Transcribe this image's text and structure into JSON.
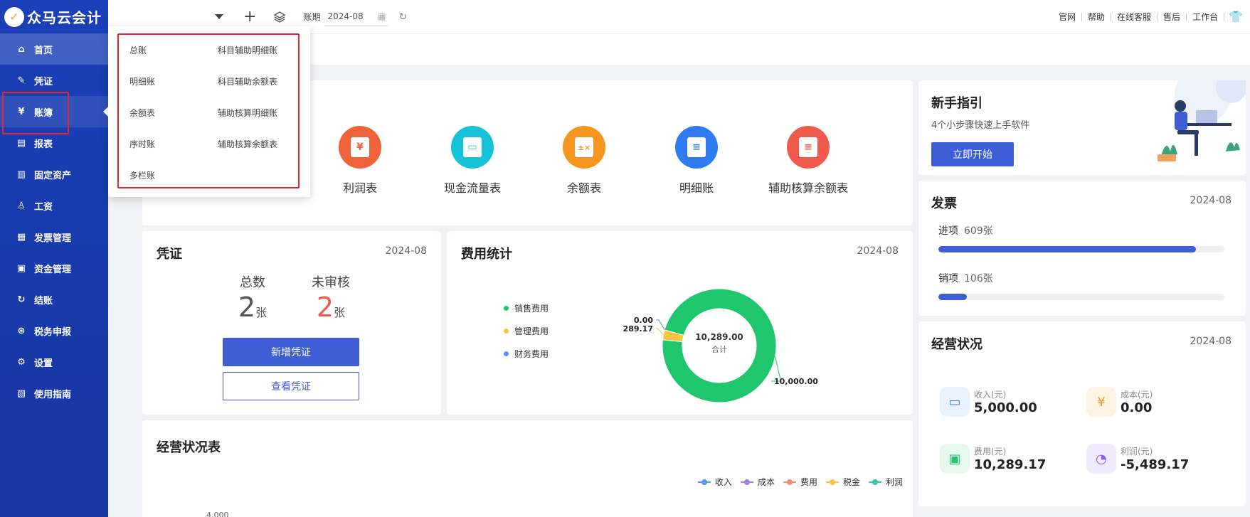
{
  "app": {
    "name": "众马云会计"
  },
  "nav": {
    "items": [
      {
        "label": "首页"
      },
      {
        "label": "凭证"
      },
      {
        "label": "账簿"
      },
      {
        "label": "报表"
      },
      {
        "label": "固定资产"
      },
      {
        "label": "工资"
      },
      {
        "label": "发票管理"
      },
      {
        "label": "资金管理"
      },
      {
        "label": "结账"
      },
      {
        "label": "税务申报"
      },
      {
        "label": "设置"
      },
      {
        "label": "使用指南"
      }
    ]
  },
  "topbar": {
    "period_label": "账期",
    "period_value": "2024-08",
    "links": [
      "官网",
      "帮助",
      "在线客服",
      "售后",
      "工作台"
    ]
  },
  "dropdown": {
    "left": [
      "总账",
      "明细账",
      "余额表",
      "序时账",
      "多栏账"
    ],
    "right": [
      "科目辅助明细账",
      "科目辅助余额表",
      "辅助核算明细账",
      "辅助核算余额表"
    ]
  },
  "quick": {
    "items": [
      {
        "label": "利润表",
        "icon": "yen-document-icon",
        "color": "#f0623a"
      },
      {
        "label": "现金流量表",
        "icon": "wallet-icon",
        "color": "#17c3d9"
      },
      {
        "label": "余额表",
        "icon": "calculator-icon",
        "color": "#f7961e"
      },
      {
        "label": "明细账",
        "icon": "clipboard-icon",
        "color": "#2f7cf2"
      },
      {
        "label": "辅助核算余额表",
        "icon": "document-icon",
        "color": "#f05a4a"
      }
    ]
  },
  "voucher": {
    "title": "凭证",
    "date": "2024-08",
    "total_label": "总数",
    "total_value": "2",
    "unreviewed_label": "未审核",
    "unreviewed_value": "2",
    "unit": "张",
    "add_button": "新增凭证",
    "view_button": "查看凭证"
  },
  "expense": {
    "title": "费用统计",
    "date": "2024-08",
    "legend": [
      {
        "label": "销售费用",
        "color": "#1fc66e"
      },
      {
        "label": "管理费用",
        "color": "#f5c542"
      },
      {
        "label": "财务费用",
        "color": "#5b8ff9"
      }
    ],
    "center_value": "10,289.00",
    "center_label": "合计"
  },
  "chart_data": {
    "type": "pie",
    "categories": [
      "销售费用",
      "管理费用",
      "财务费用"
    ],
    "values": [
      10000.0,
      289.17,
      0.0
    ],
    "value_labels": [
      "10,000.00",
      "289.17",
      "0.00"
    ],
    "colors": [
      "#1fc66e",
      "#f5c542",
      "#5b8ff9"
    ]
  },
  "business": {
    "title": "经营状况表",
    "legend": [
      {
        "label": "收入",
        "color": "#5b8ff9"
      },
      {
        "label": "成本",
        "color": "#9c7ef0"
      },
      {
        "label": "费用",
        "color": "#f78a7a"
      },
      {
        "label": "税金",
        "color": "#f5c542"
      },
      {
        "label": "利润",
        "color": "#34c9a7"
      }
    ],
    "y_tick": "4,000"
  },
  "guide": {
    "title": "新手指引",
    "subtitle": "4个小步骤快速上手软件",
    "button": "立即开始"
  },
  "invoice": {
    "title": "发票",
    "date": "2024-08",
    "in_label": "进项",
    "in_value": "609张",
    "in_fraction": 0.9,
    "out_label": "销项",
    "out_value": "106张",
    "out_fraction": 0.1
  },
  "operation": {
    "title": "经营状况",
    "date": "2024-08",
    "items": [
      {
        "label": "收入(元)",
        "value": "5,000.00",
        "color": "#3e7ff2",
        "bg": "#eaf2ff"
      },
      {
        "label": "成本(元)",
        "value": "0.00",
        "color": "#f7961e",
        "bg": "#fff3e3"
      },
      {
        "label": "费用(元)",
        "value": "10,289.17",
        "color": "#1fc66e",
        "bg": "#e7f8ee"
      },
      {
        "label": "利润(元)",
        "value": "-5,489.17",
        "color": "#8a5cf0",
        "bg": "#f1ebff"
      }
    ]
  }
}
